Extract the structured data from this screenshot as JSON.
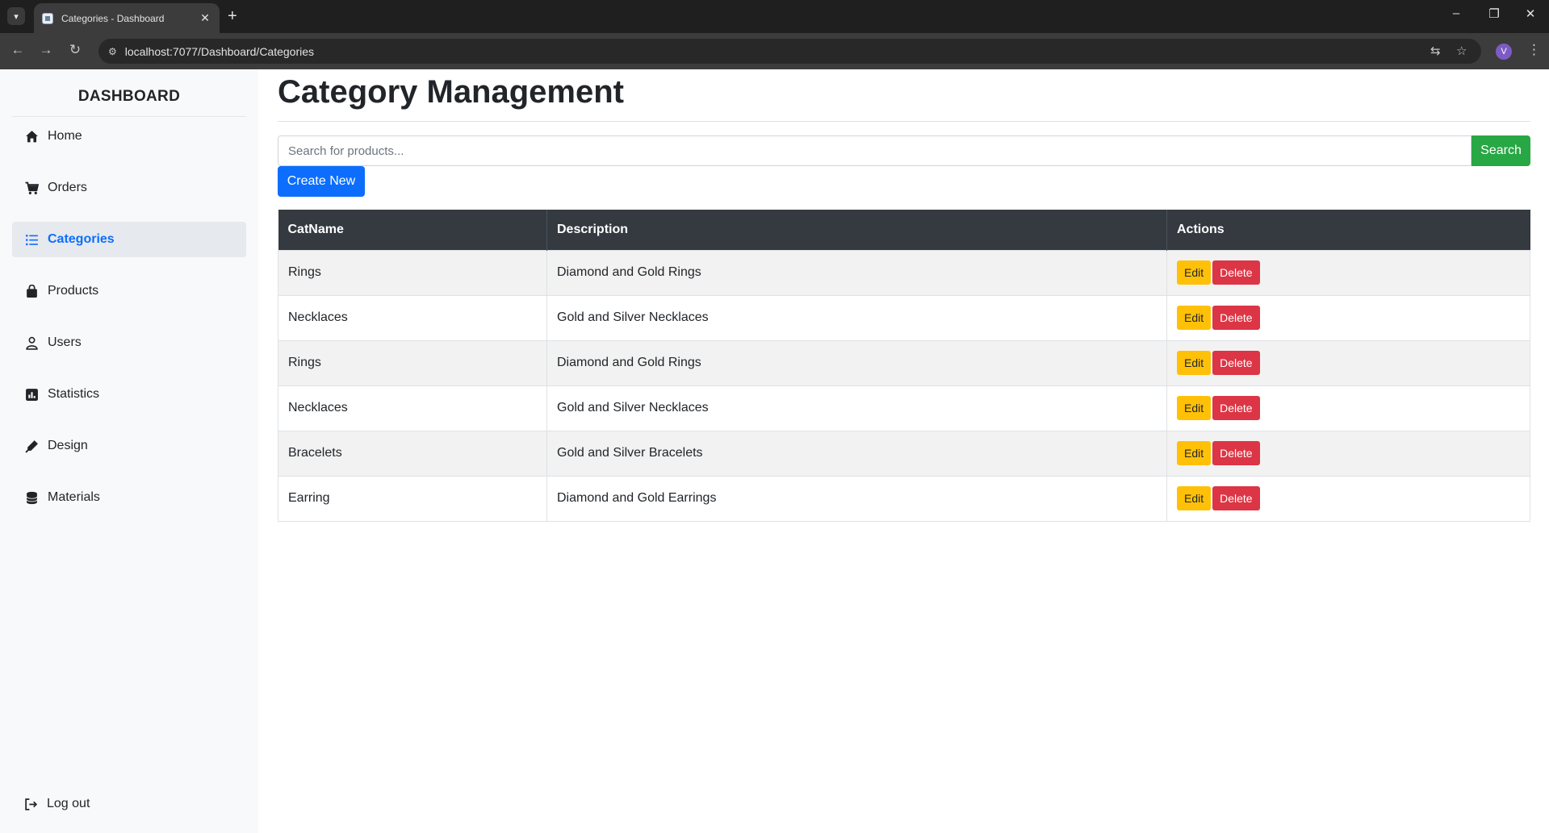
{
  "browser": {
    "tab_title": "Categories - Dashboard",
    "tab_close": "✕",
    "new_tab": "+",
    "url": "localhost:7077/Dashboard/Categories",
    "profile_initial": "V",
    "window_controls": [
      "–",
      "❐",
      "✕"
    ]
  },
  "sidebar": {
    "brand": "DASHBOARD",
    "items": [
      {
        "label": "Home",
        "icon": "home-icon"
      },
      {
        "label": "Orders",
        "icon": "cart-icon"
      },
      {
        "label": "Categories",
        "icon": "list-icon",
        "active": true
      },
      {
        "label": "Products",
        "icon": "bag-icon"
      },
      {
        "label": "Users",
        "icon": "user-icon"
      },
      {
        "label": "Statistics",
        "icon": "chart-icon"
      },
      {
        "label": "Design",
        "icon": "pen-icon"
      },
      {
        "label": "Materials",
        "icon": "database-icon"
      }
    ],
    "logout": "Log out"
  },
  "main": {
    "title": "Category Management",
    "search_placeholder": "Search for products...",
    "search_button": "Search",
    "create_button": "Create New",
    "table": {
      "headers": [
        "CatName",
        "Description",
        "Actions"
      ],
      "rows": [
        {
          "name": "Rings",
          "description": "Diamond and Gold Rings"
        },
        {
          "name": "Necklaces",
          "description": "Gold and Silver Necklaces"
        },
        {
          "name": "Rings",
          "description": "Diamond and Gold Rings"
        },
        {
          "name": "Necklaces",
          "description": "Gold and Silver Necklaces"
        },
        {
          "name": "Bracelets",
          "description": "Gold and Silver Bracelets"
        },
        {
          "name": "Earring",
          "description": "Diamond and Gold Earrings"
        }
      ],
      "edit_label": "Edit",
      "delete_label": "Delete"
    }
  },
  "colors": {
    "primary": "#0d6efd",
    "success": "#28a745",
    "warning": "#ffc107",
    "danger": "#dc3545",
    "table_header": "#343a40"
  }
}
